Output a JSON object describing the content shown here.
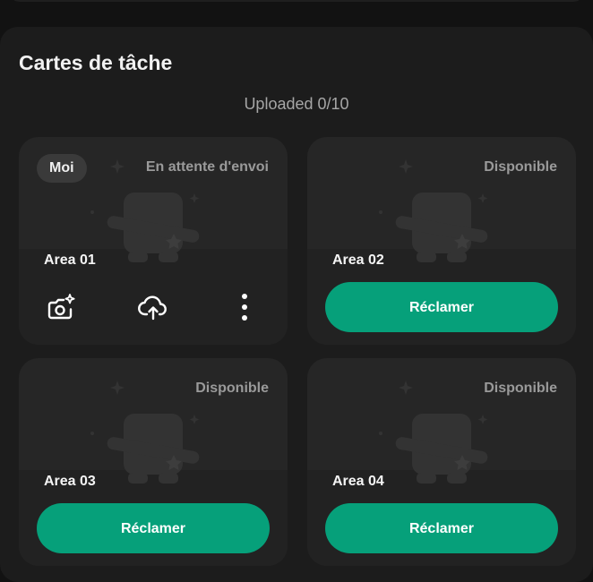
{
  "header": {
    "title": "Cartes de tâche",
    "progress": "Uploaded 0/10"
  },
  "cards": [
    {
      "owner_badge": "Moi",
      "status": "En attente d'envoi",
      "area": "Area 01",
      "actions": [
        "camera-sparkle-icon",
        "cloud-upload-icon",
        "more-vertical-icon"
      ]
    },
    {
      "status": "Disponible",
      "area": "Area 02",
      "claim_label": "Réclamer"
    },
    {
      "status": "Disponible",
      "area": "Area 03",
      "claim_label": "Réclamer"
    },
    {
      "status": "Disponible",
      "area": "Area 04",
      "claim_label": "Réclamer"
    }
  ],
  "colors": {
    "accent": "#06a07a",
    "card": "#262626",
    "panel": "#1c1c1c",
    "background": "#121212"
  }
}
